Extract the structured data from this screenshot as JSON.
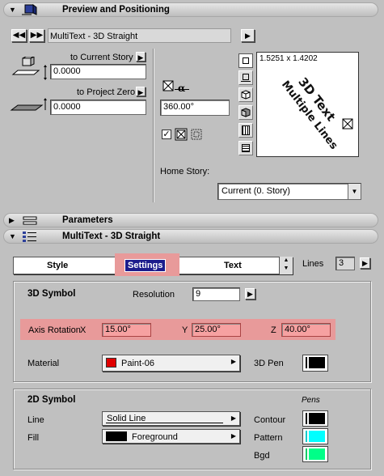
{
  "preview": {
    "title": "Preview and Positioning",
    "object_name": "MultiText - 3D Straight",
    "to_current_story": "to Current Story",
    "current_story_value": "0.0000",
    "to_project_zero": "to Project Zero",
    "project_zero_value": "0.0000",
    "angle_label": "α",
    "angle_value": "360.00°",
    "dimensions": "1.5251 x 1.4202",
    "preview_text": [
      "3D Text",
      "Multiple Lines"
    ],
    "home_story_label": "Home Story:",
    "home_story_value": "Current (0. Story)"
  },
  "parameters": {
    "title": "Parameters"
  },
  "settings_panel": {
    "title": "MultiText - 3D Straight",
    "tabs": [
      "Style",
      "Settings",
      "Text"
    ],
    "lines_label": "Lines",
    "lines_value": "3",
    "symbol3d": {
      "title": "3D Symbol",
      "resolution_label": "Resolution",
      "resolution_value": "9",
      "axis_rotation_label": "Axis Rotation",
      "x_label": "X",
      "x_value": "15.00°",
      "y_label": "Y",
      "y_value": "25.00°",
      "z_label": "Z",
      "z_value": "40.00°",
      "material_label": "Material",
      "material_value": "Paint-06",
      "material_color": "#e00000",
      "pen_label": "3D Pen"
    },
    "symbol2d": {
      "title": "2D Symbol",
      "pens_label": "Pens",
      "line_label": "Line",
      "line_value": "Solid Line",
      "fill_label": "Fill",
      "fill_value": "Foreground",
      "contour_label": "Contour",
      "pattern_label": "Pattern",
      "bgd_label": "Bgd",
      "pattern_color": "#00ffff",
      "bgd_color": "#00ff88"
    },
    "highlight_color": "#e89a9a"
  }
}
